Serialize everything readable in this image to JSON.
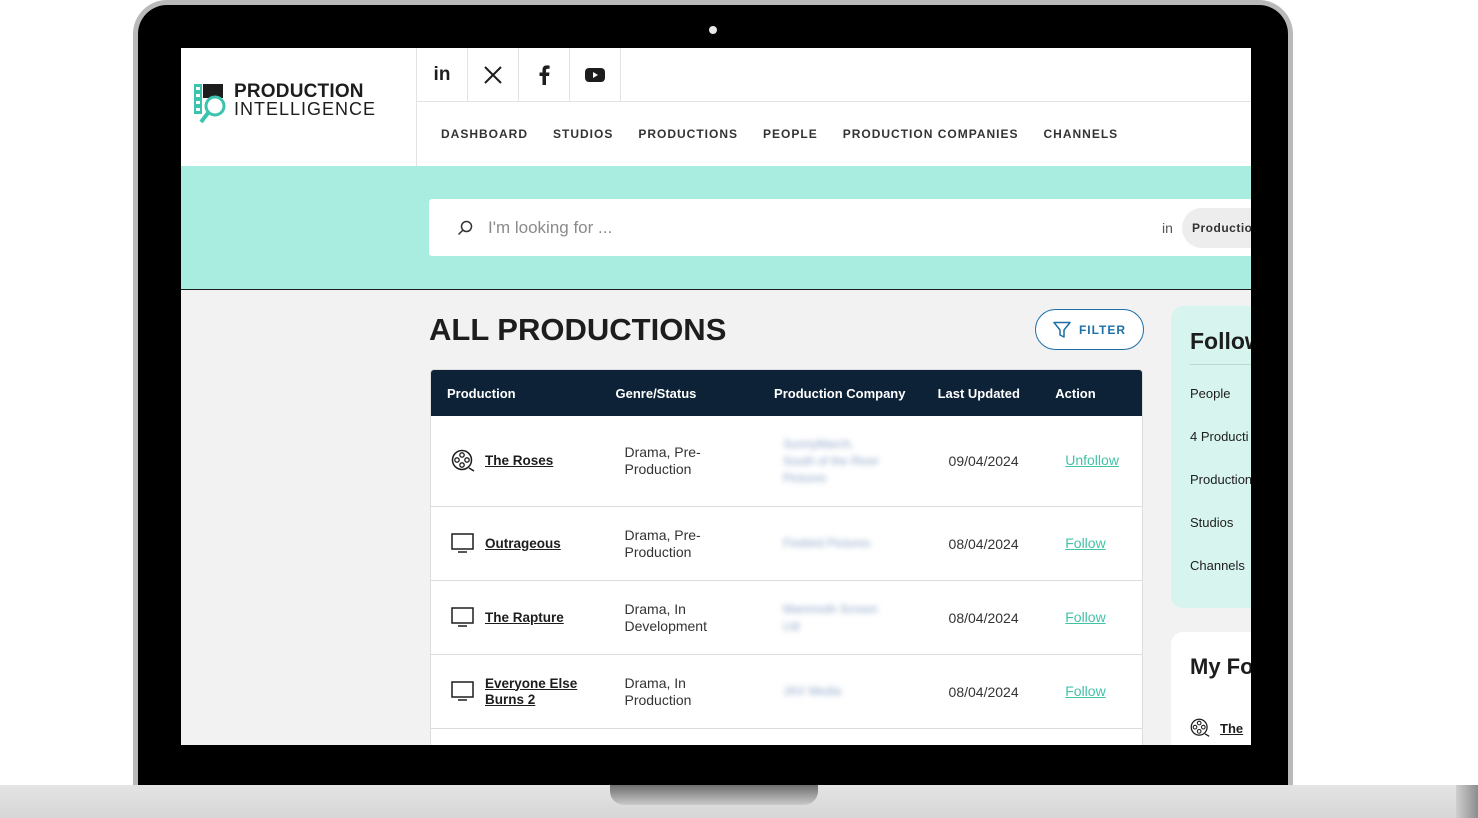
{
  "brand": {
    "line1": "PRODUCTION",
    "line2": "INTELLIGENCE",
    "accent": "#3cc3ad"
  },
  "social": [
    {
      "icon": "linkedin-icon",
      "label": "in"
    },
    {
      "icon": "x-icon"
    },
    {
      "icon": "facebook-icon"
    },
    {
      "icon": "youtube-icon"
    }
  ],
  "nav": [
    "DASHBOARD",
    "STUDIOS",
    "PRODUCTIONS",
    "PEOPLE",
    "PRODUCTION COMPANIES",
    "CHANNELS"
  ],
  "search": {
    "placeholder": "I'm looking for ...",
    "in_label": "in",
    "scope": "Productio"
  },
  "page": {
    "title": "ALL PRODUCTIONS",
    "filter_label": "FILTER"
  },
  "table": {
    "headers": [
      "Production",
      "Genre/Status",
      "Production Company",
      "Last Updated",
      "Action"
    ],
    "rows": [
      {
        "icon": "film-reel-icon",
        "name_l1": "The Roses",
        "name_l2": "",
        "genre_l1": "Drama, Pre-",
        "genre_l2": "Production",
        "company_l1": "SunnyMarch,",
        "company_l2": "South of the River",
        "company_l3": "Pictures",
        "date": "09/04/2024",
        "action": "Unfollow"
      },
      {
        "icon": "tv-icon",
        "name_l1": "Outrageous",
        "name_l2": "",
        "genre_l1": "Drama, Pre-",
        "genre_l2": "Production",
        "company_l1": "Firebird Pictures",
        "company_l2": "",
        "company_l3": "",
        "date": "08/04/2024",
        "action": "Follow"
      },
      {
        "icon": "tv-icon",
        "name_l1": "The Rapture",
        "name_l2": "",
        "genre_l1": "Drama, In",
        "genre_l2": "Development",
        "company_l1": "Mammoth Screen",
        "company_l2": "Ltd",
        "company_l3": "",
        "date": "08/04/2024",
        "action": "Follow"
      },
      {
        "icon": "tv-icon",
        "name_l1": "Everyone Else",
        "name_l2": "Burns 2",
        "genre_l1": "Drama, In",
        "genre_l2": "Production",
        "company_l1": "JAX Media",
        "company_l2": "",
        "company_l3": "",
        "date": "08/04/2024",
        "action": "Follow"
      }
    ]
  },
  "side": {
    "title": "Follow",
    "items": [
      "People",
      "4 Producti",
      "Production",
      "Studios",
      "Channels"
    ],
    "title2": "My Fo",
    "item2": "The"
  }
}
